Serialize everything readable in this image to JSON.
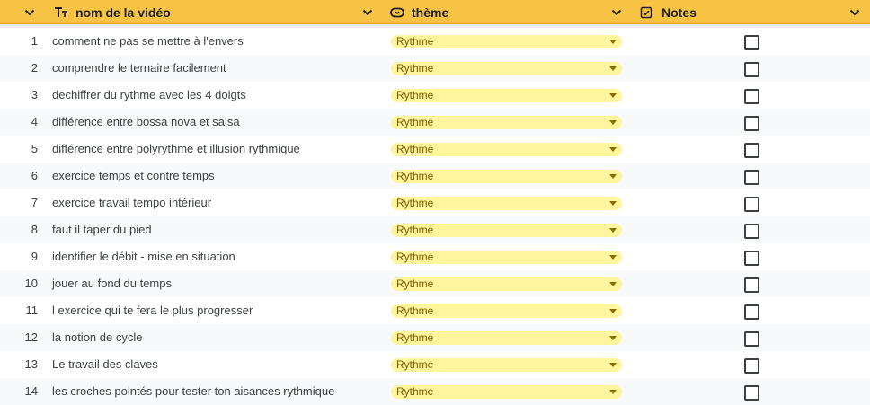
{
  "header": {
    "columns": [
      {
        "key": "nom",
        "label": "nom de la vidéo",
        "icon": "text-type-icon"
      },
      {
        "key": "theme",
        "label": "thème",
        "icon": "dropdown-chip-icon"
      },
      {
        "key": "notes",
        "label": "Notes",
        "icon": "checkbox-icon"
      }
    ]
  },
  "colors": {
    "header_bg": "#f6c344",
    "chip_bg": "#fff59d",
    "chip_text": "#7a5a00"
  },
  "rows": [
    {
      "num": "1",
      "title": "comment ne pas se mettre à l'envers",
      "theme": "Rythme",
      "notes": false
    },
    {
      "num": "2",
      "title": "comprendre le ternaire facilement",
      "theme": "Rythme",
      "notes": false
    },
    {
      "num": "3",
      "title": "dechiffrer du rythme avec les 4 doigts",
      "theme": "Rythme",
      "notes": false
    },
    {
      "num": "4",
      "title": "différence entre bossa nova et salsa",
      "theme": "Rythme",
      "notes": false
    },
    {
      "num": "5",
      "title": "différence entre polyrythme et illusion rythmique",
      "theme": "Rythme",
      "notes": false
    },
    {
      "num": "6",
      "title": "exercice temps et contre temps",
      "theme": "Rythme",
      "notes": false
    },
    {
      "num": "7",
      "title": "exercice travail tempo intérieur",
      "theme": "Rythme",
      "notes": false
    },
    {
      "num": "8",
      "title": "faut il taper du pied",
      "theme": "Rythme",
      "notes": false
    },
    {
      "num": "9",
      "title": "identifier le débit - mise en situation",
      "theme": "Rythme",
      "notes": false
    },
    {
      "num": "10",
      "title": "jouer au fond du temps",
      "theme": "Rythme",
      "notes": false
    },
    {
      "num": "11",
      "title": "l exercice qui te fera le plus progresser",
      "theme": "Rythme",
      "notes": false
    },
    {
      "num": "12",
      "title": "la notion de cycle",
      "theme": "Rythme",
      "notes": false
    },
    {
      "num": "13",
      "title": "Le travail des claves",
      "theme": "Rythme",
      "notes": false
    },
    {
      "num": "14",
      "title": "les croches pointés pour tester ton aisances rythmique",
      "theme": "Rythme",
      "notes": false
    }
  ]
}
